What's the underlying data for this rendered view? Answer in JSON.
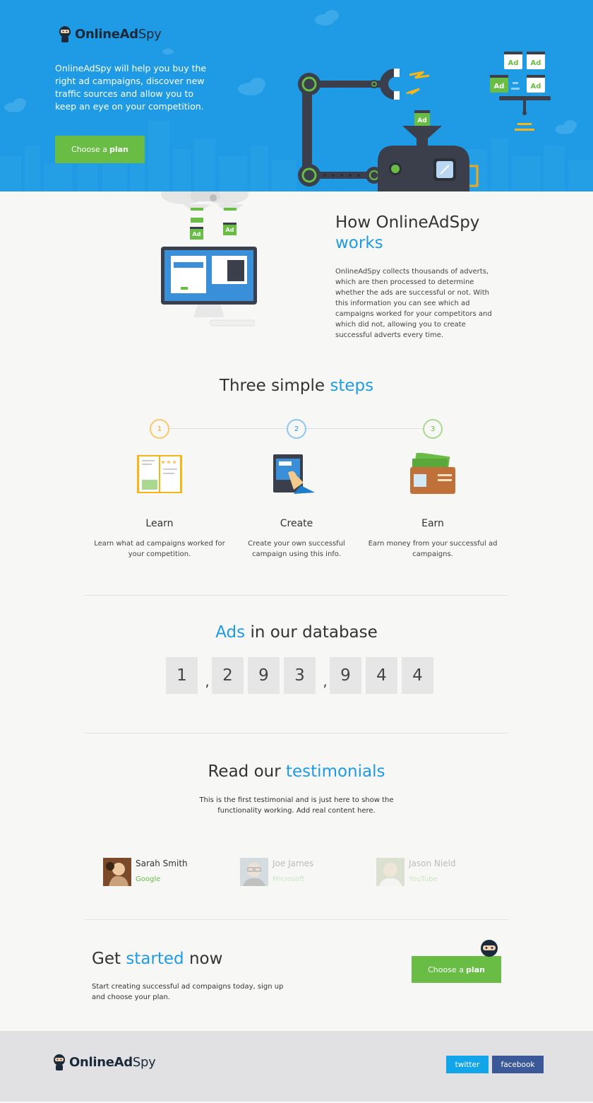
{
  "brand": {
    "name_bold": "OnlineAd",
    "name_light": "Spy"
  },
  "hero": {
    "text": "OnlineAdSpy will help you buy the right ad campaigns, discover new traffic sources and allow you to keep an eye on your competition.",
    "button_pre": "Choose a",
    "button_bold": "plan",
    "ad_label": "Ad"
  },
  "how": {
    "title_main": "How OnlineAdSpy",
    "title_accent": "works",
    "description": "OnlineAdSpy collects thousands of adverts, which are then processed to determine whether the ads are successful or not. With this information you can see which ad campaigns worked for your competitors and which did not, allowing you to create successful adverts every time.",
    "ad_label": "Ad"
  },
  "steps": {
    "title_main": "Three simple",
    "title_accent": "steps",
    "items": [
      {
        "num": "1",
        "name": "Learn",
        "desc": "Learn what ad campaigns worked for your competition.",
        "color": "#f9c96b"
      },
      {
        "num": "2",
        "name": "Create",
        "desc": "Create your own successful campaign using this info.",
        "color": "#8cc7ef"
      },
      {
        "num": "3",
        "name": "Earn",
        "desc": "Earn money from your successful ad campaigns.",
        "color": "#a9d98f"
      }
    ]
  },
  "database": {
    "title_accent": "Ads",
    "title_main": "in our database",
    "digits": [
      "1",
      ",",
      "2",
      "9",
      "3",
      ",",
      "9",
      "4",
      "4"
    ]
  },
  "testimonials": {
    "title_main": "Read our",
    "title_accent": "testimonials",
    "text": "This is the first testimonial and is just here to show the functionality working. Add real content here.",
    "people": [
      {
        "name": "Sarah Smith",
        "company": "Google"
      },
      {
        "name": "Joe James",
        "company": "Microsoft"
      },
      {
        "name": "Jason Nield",
        "company": "YouTube"
      }
    ]
  },
  "cta": {
    "title_pre": "Get",
    "title_accent": "started",
    "title_post": "now",
    "text": "Start creating successful ad compaigns today, sign up and choose your plan.",
    "button_pre": "Choose a",
    "button_bold": "plan"
  },
  "footer": {
    "twitter": "twitter",
    "facebook": "facebook"
  },
  "colors": {
    "hero_bg": "#1e9be4",
    "accent_blue": "#1e9be4",
    "green": "#69bd45",
    "twitter": "#12a5ea",
    "facebook": "#3b5998",
    "footer_bg": "#e1e1e3"
  }
}
